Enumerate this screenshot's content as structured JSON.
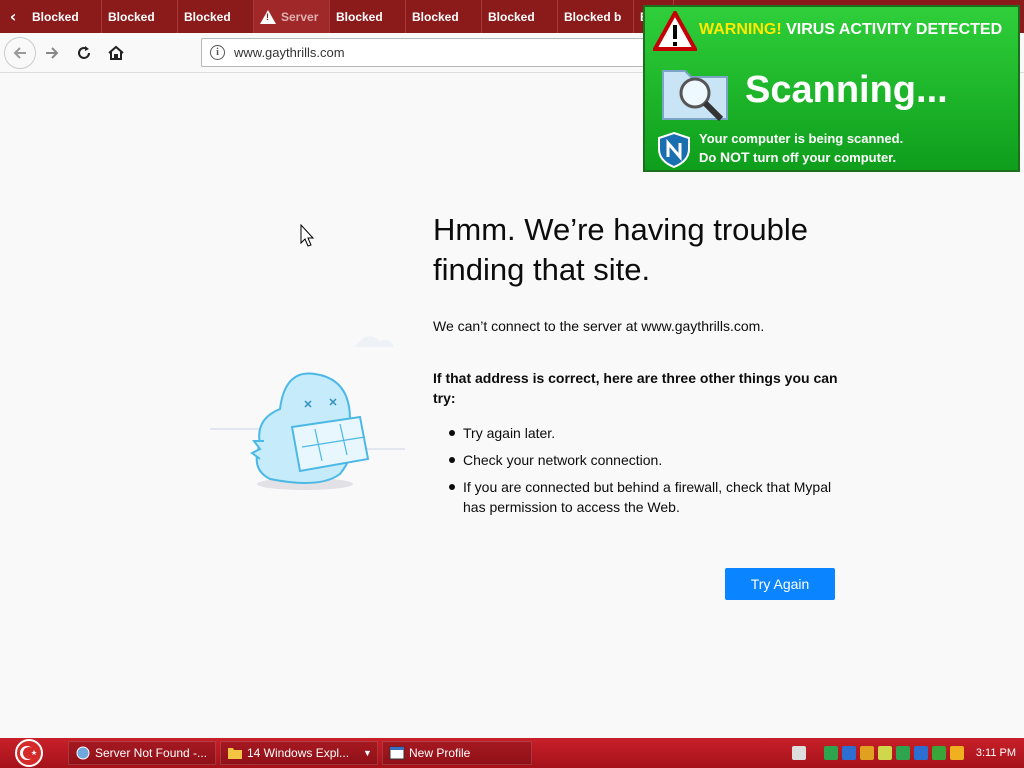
{
  "tabs": [
    {
      "label": "Blocked"
    },
    {
      "label": "Blocked"
    },
    {
      "label": "Blocked"
    },
    {
      "label": "Server"
    },
    {
      "label": "Blocked"
    },
    {
      "label": "Blocked"
    },
    {
      "label": "Blocked"
    },
    {
      "label": "Blocked b"
    },
    {
      "label": "B"
    }
  ],
  "navbar": {
    "url": "www.gaythrills.com"
  },
  "page": {
    "title": "Hmm. We’re having trouble finding that site.",
    "subtitle": "We can’t connect to the server at www.gaythrills.com.",
    "tries_heading": "If that address is correct, here are three other things you can try:",
    "tips": [
      "Try again later.",
      "Check your network connection.",
      "If you are connected but behind a firewall, check that Mypal has permission to access the Web."
    ],
    "try_again": "Try Again"
  },
  "popup": {
    "warning": "WARNING!",
    "heading": "VIRUS ACTIVITY DETECTED",
    "scanning": "Scanning...",
    "line1": "Your computer is being scanned.",
    "line2_pre": "Do ",
    "line2_strong": "NOT",
    "line2_post": " turn off your computer."
  },
  "taskbar": {
    "tasks": [
      {
        "label": "Server Not Found -..."
      },
      {
        "label": "14 Windows Expl..."
      },
      {
        "label": "New Profile"
      }
    ],
    "clock": "3:11 PM"
  },
  "colors": {
    "tabstrip": "#8b1a1a",
    "button": "#0a84ff",
    "popup": "#1fb52a",
    "taskbar": "#b8161f"
  }
}
